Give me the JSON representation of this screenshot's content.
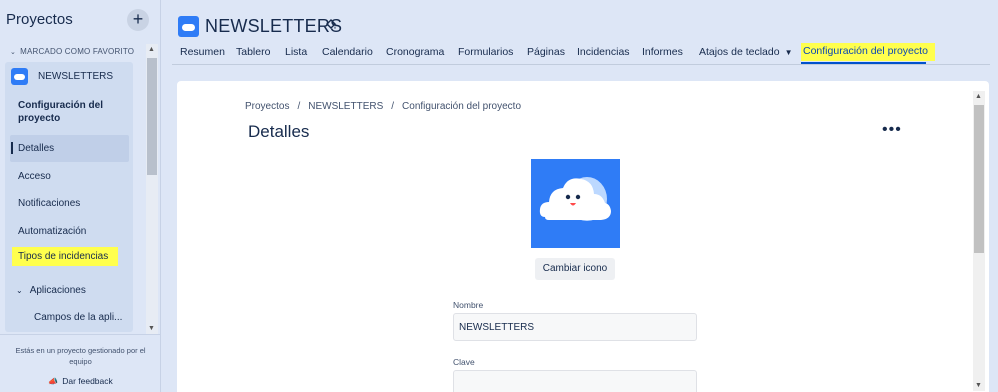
{
  "sidebar": {
    "title": "Proyectos",
    "add_label": "+",
    "favorites_label": "MARCADO COMO FAVORITO",
    "project_name": "NEWSLETTERS",
    "section_title": "Configuración del proyecto",
    "items": [
      {
        "label": "Detalles",
        "active": true
      },
      {
        "label": "Acceso"
      },
      {
        "label": "Notificaciones"
      },
      {
        "label": "Automatización"
      },
      {
        "label": "Tipos de incidencias",
        "highlighted": true
      }
    ],
    "apps_group": "Aplicaciones",
    "apps_sub": "Campos de la apli...",
    "footer_text": "Estás en un proyecto gestionado por el equipo",
    "feedback_label": "Dar feedback"
  },
  "header": {
    "project_title": "NEWSLETTERS",
    "tabs": [
      {
        "label": "Resumen"
      },
      {
        "label": "Tablero"
      },
      {
        "label": "Lista"
      },
      {
        "label": "Calendario"
      },
      {
        "label": "Cronograma"
      },
      {
        "label": "Formularios"
      },
      {
        "label": "Páginas"
      },
      {
        "label": "Incidencias"
      },
      {
        "label": "Informes"
      },
      {
        "label": "Atajos de teclado",
        "dropdown": true
      },
      {
        "label": "Configuración del proyecto",
        "active": true,
        "highlighted": true
      }
    ]
  },
  "main": {
    "breadcrumbs": [
      "Proyectos",
      "NEWSLETTERS",
      "Configuración del proyecto"
    ],
    "breadcrumb_sep": "/",
    "page_title": "Detalles",
    "more_label": "•••",
    "change_icon_label": "Cambiar icono",
    "name_label": "Nombre",
    "name_value": "NEWSLETTERS",
    "key_label": "Clave",
    "key_value": ""
  },
  "colors": {
    "accent": "#0052cc",
    "highlight": "#ffff4d",
    "project_icon": "#2f7cf6",
    "sidebar_bg": "#dde6f6"
  },
  "icons": [
    "plus-icon",
    "chevron-down-icon",
    "cloud-icon",
    "paint-bucket-icon",
    "megaphone-icon",
    "more-icon"
  ]
}
